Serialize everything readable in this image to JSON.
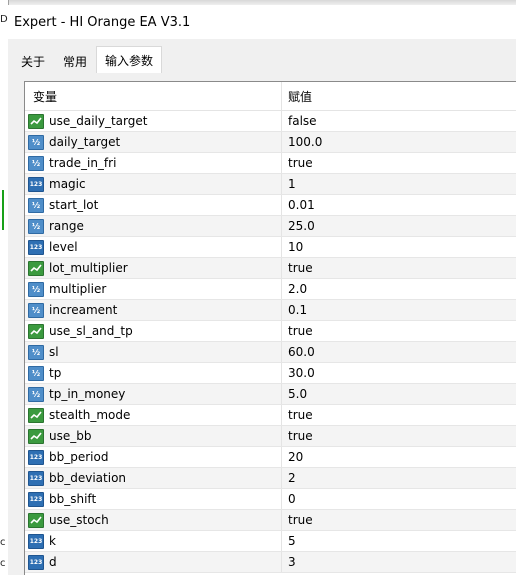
{
  "window": {
    "title": "Expert - HI Orange EA V3.1"
  },
  "tabs": [
    {
      "label": "关于",
      "active": false
    },
    {
      "label": "常用",
      "active": false
    },
    {
      "label": "输入参数",
      "active": true
    }
  ],
  "table": {
    "headers": {
      "variable": "变量",
      "value": "赋值"
    },
    "rows": [
      {
        "name": "use_daily_target",
        "value": "false",
        "icon": "bool-icon"
      },
      {
        "name": "daily_target",
        "value": "100.0",
        "icon": "double-icon"
      },
      {
        "name": "trade_in_fri",
        "value": "true",
        "icon": "double-icon"
      },
      {
        "name": "magic",
        "value": "1",
        "icon": "int-icon"
      },
      {
        "name": "start_lot",
        "value": "0.01",
        "icon": "double-icon"
      },
      {
        "name": "range",
        "value": "25.0",
        "icon": "double-icon"
      },
      {
        "name": "level",
        "value": "10",
        "icon": "int-icon"
      },
      {
        "name": "lot_multiplier",
        "value": "true",
        "icon": "bool-icon"
      },
      {
        "name": "multiplier",
        "value": "2.0",
        "icon": "double-icon"
      },
      {
        "name": "increament",
        "value": "0.1",
        "icon": "double-icon"
      },
      {
        "name": "use_sl_and_tp",
        "value": "true",
        "icon": "bool-icon"
      },
      {
        "name": "sl",
        "value": "60.0",
        "icon": "double-icon"
      },
      {
        "name": "tp",
        "value": "30.0",
        "icon": "double-icon"
      },
      {
        "name": "tp_in_money",
        "value": "5.0",
        "icon": "double-icon"
      },
      {
        "name": "stealth_mode",
        "value": "true",
        "icon": "bool-icon"
      },
      {
        "name": "use_bb",
        "value": "true",
        "icon": "bool-icon"
      },
      {
        "name": "bb_period",
        "value": "20",
        "icon": "int-icon"
      },
      {
        "name": "bb_deviation",
        "value": "2",
        "icon": "int-icon"
      },
      {
        "name": "bb_shift",
        "value": "0",
        "icon": "int-icon"
      },
      {
        "name": "use_stoch",
        "value": "true",
        "icon": "bool-icon"
      },
      {
        "name": "k",
        "value": "5",
        "icon": "int-icon"
      },
      {
        "name": "d",
        "value": "3",
        "icon": "int-icon"
      }
    ]
  },
  "background": {
    "fragments": [
      "D",
      "c",
      "c",
      "l",
      "l",
      "l",
      "l"
    ]
  },
  "colors": {
    "bool_icon": "#3b9a3f",
    "double_icon": "#4f8ec9",
    "int_icon": "#2e6fb3"
  }
}
